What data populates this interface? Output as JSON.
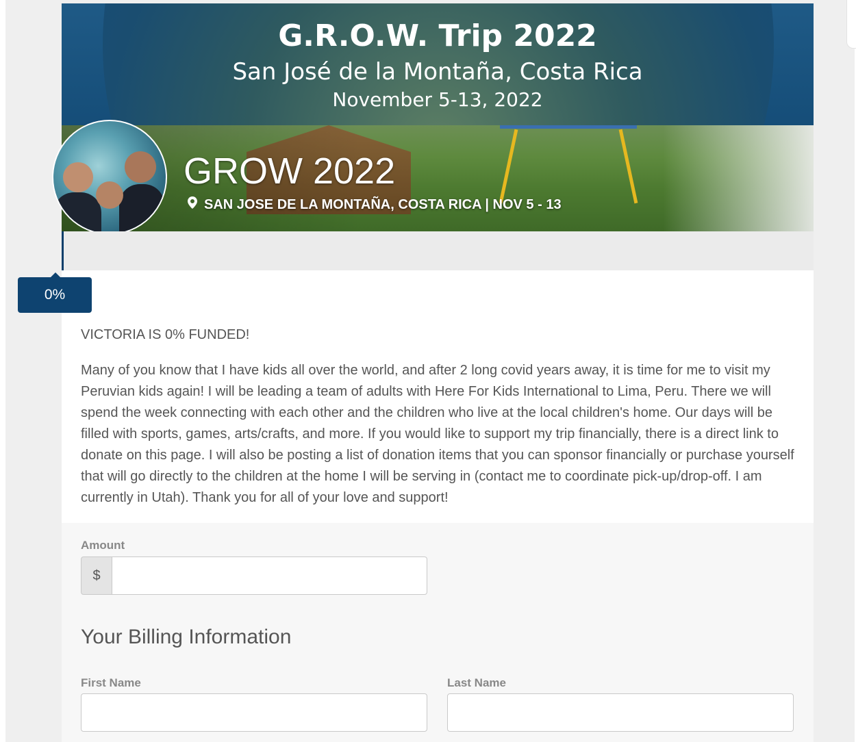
{
  "banner": {
    "title": "G.R.O.W. Trip 2022",
    "subtitle": "San José de la Montaña, Costa Rica",
    "dates": "November 5-13, 2022"
  },
  "campaign": {
    "name": "GROW 2022",
    "location": "SAN JOSE DE LA MONTAÑA, COSTA RICA | NOV 5 - 13"
  },
  "progress": {
    "percent_label": "0%",
    "percent_value": 0,
    "funded_text": "VICTORIA IS 0% FUNDED!"
  },
  "story": "Many of you know that I have kids all over the world, and after 2 long covid years away, it is time for me to visit my Peruvian kids again! I will be leading a team of adults with Here For Kids International to Lima, Peru. There we will spend the week connecting with each other and the children who live at the local children's home. Our days will be filled with sports, games, arts/crafts, and more. If you would like to support my trip financially, there is a direct link to donate on this page. I will also be posting a list of donation items that you can sponsor financially or purchase yourself that will go directly to the children at the home I will be serving in (contact me to coordinate pick-up/drop-off. I am currently in Utah). Thank you for all of your love and support!",
  "form": {
    "amount_label": "Amount",
    "currency_symbol": "$",
    "amount_value": "",
    "billing_title": "Your Billing Information",
    "first_name_label": "First Name",
    "first_name_value": "",
    "last_name_label": "Last Name",
    "last_name_value": ""
  },
  "colors": {
    "brand": "#0e4370",
    "text": "#555555"
  },
  "icons": {
    "location": "map-pin-icon"
  }
}
